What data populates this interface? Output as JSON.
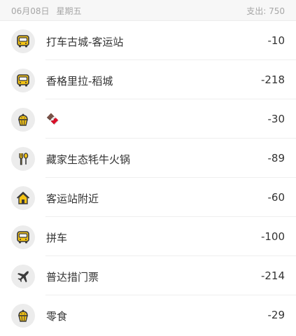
{
  "header": {
    "date": "06月08日",
    "weekday": "星期五",
    "spend_label": "支出:",
    "spend_value": "750"
  },
  "items": [
    {
      "icon": "bus-icon",
      "label": "打车古城-客运站",
      "amount": "-10"
    },
    {
      "icon": "bus-icon",
      "label": "香格里拉-稻城",
      "amount": "-218"
    },
    {
      "icon": "cupcake-icon",
      "label": "🍫",
      "amount": "-30"
    },
    {
      "icon": "fork-spoon-icon",
      "label": "藏家生态牦牛火锅",
      "amount": "-89"
    },
    {
      "icon": "house-icon",
      "label": "客运站附近",
      "amount": "-60"
    },
    {
      "icon": "bus-icon",
      "label": "拼车",
      "amount": "-100"
    },
    {
      "icon": "airplane-icon",
      "label": "普达措门票",
      "amount": "-214"
    },
    {
      "icon": "cupcake-icon",
      "label": "零食",
      "amount": "-29"
    }
  ],
  "colors": {
    "icon_yellow": "#f5c414",
    "icon_outline": "#3a3a3a",
    "icon_bg": "#ececec",
    "header_bg": "#f7f7f7",
    "muted_text": "#a6a6a6"
  }
}
